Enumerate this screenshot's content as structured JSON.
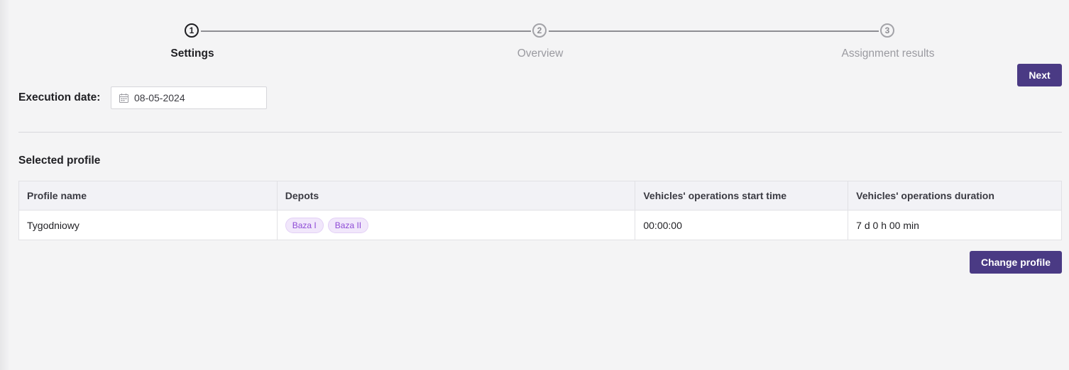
{
  "stepper": {
    "steps": [
      {
        "number": "1",
        "label": "Settings",
        "state": "active"
      },
      {
        "number": "2",
        "label": "Overview",
        "state": "inactive"
      },
      {
        "number": "3",
        "label": "Assignment results",
        "state": "inactive"
      }
    ]
  },
  "actions": {
    "next_label": "Next",
    "change_profile_label": "Change profile"
  },
  "execution": {
    "label": "Execution date:",
    "date_value": "08-05-2024",
    "icon": "calendar-icon"
  },
  "selected_profile": {
    "title": "Selected profile",
    "columns": [
      "Profile name",
      "Depots",
      "Vehicles' operations start time",
      "Vehicles' operations duration"
    ],
    "rows": [
      {
        "profile_name": "Tygodniowy",
        "depots": [
          "Baza I",
          "Baza II"
        ],
        "start_time": "00:00:00",
        "duration": "7 d 0 h 00 min"
      }
    ]
  },
  "colors": {
    "accent": "#4a3a84",
    "tag_bg": "#f1e7fb",
    "tag_text": "#8e4bd6"
  }
}
